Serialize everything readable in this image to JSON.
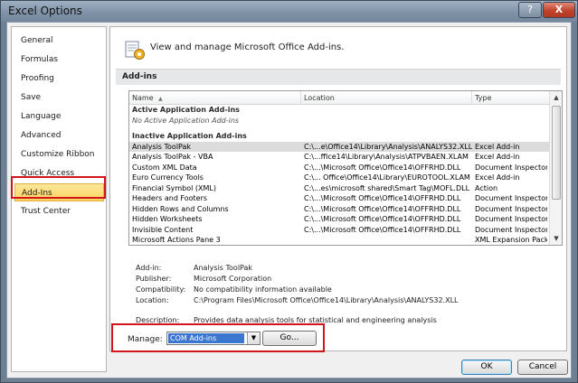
{
  "window": {
    "title": "Excel Options",
    "help_glyph": "?",
    "close_glyph": "X"
  },
  "nav": {
    "items": [
      {
        "label": "General"
      },
      {
        "label": "Formulas"
      },
      {
        "label": "Proofing"
      },
      {
        "label": "Save"
      },
      {
        "label": "Language"
      },
      {
        "label": "Advanced"
      },
      {
        "label": "Customize Ribbon"
      },
      {
        "label": "Quick Access Toolbar"
      },
      {
        "label": "Add-Ins",
        "selected": true
      },
      {
        "label": "Trust Center"
      }
    ]
  },
  "header": {
    "text": "View and manage Microsoft Office Add-ins.",
    "icon": "addins-gear-icon"
  },
  "section": {
    "title": "Add-ins"
  },
  "grid": {
    "columns": [
      "Name",
      "Location",
      "Type"
    ],
    "sort_glyph": "▲",
    "active_group": "Active Application Add-ins",
    "active_empty": "No Active Application Add-ins",
    "inactive_group": "Inactive Application Add-ins",
    "rows": [
      {
        "name": "Analysis ToolPak",
        "location": "C:\\...e\\Office14\\Library\\Analysis\\ANALYS32.XLL",
        "type": "Excel Add-in",
        "selected": true
      },
      {
        "name": "Analysis ToolPak - VBA",
        "location": "C:\\...ffice14\\Library\\Analysis\\ATPVBAEN.XLAM",
        "type": "Excel Add-in"
      },
      {
        "name": "Custom XML Data",
        "location": "C:\\...\\Microsoft Office\\Office14\\OFFRHD.DLL",
        "type": "Document Inspector"
      },
      {
        "name": "Euro Currency Tools",
        "location": "C:\\... Office\\Office14\\Library\\EUROTOOL.XLAM",
        "type": "Excel Add-in"
      },
      {
        "name": "Financial Symbol (XML)",
        "location": "C:\\...es\\microsoft shared\\Smart Tag\\MOFL.DLL",
        "type": "Action"
      },
      {
        "name": "Headers and Footers",
        "location": "C:\\...\\Microsoft Office\\Office14\\OFFRHD.DLL",
        "type": "Document Inspector"
      },
      {
        "name": "Hidden Rows and Columns",
        "location": "C:\\...\\Microsoft Office\\Office14\\OFFRHD.DLL",
        "type": "Document Inspector"
      },
      {
        "name": "Hidden Worksheets",
        "location": "C:\\...\\Microsoft Office\\Office14\\OFFRHD.DLL",
        "type": "Document Inspector"
      },
      {
        "name": "Invisible Content",
        "location": "C:\\...\\Microsoft Office\\Office14\\OFFRHD.DLL",
        "type": "Document Inspector"
      },
      {
        "name": "Microsoft Actions Pane 3",
        "location": "",
        "type": "XML Expansion Pack"
      }
    ]
  },
  "details": {
    "addin_label": "Add-in:",
    "addin_value": "Analysis ToolPak",
    "publisher_label": "Publisher:",
    "publisher_value": "Microsoft Corporation",
    "compat_label": "Compatibility:",
    "compat_value": "No compatibility information available",
    "location_label": "Location:",
    "location_value": "C:\\Program Files\\Microsoft Office\\Office14\\Library\\Analysis\\ANALYS32.XLL",
    "desc_label": "Description:",
    "desc_value": "Provides data analysis tools for statistical and engineering analysis"
  },
  "manage": {
    "label": "Manage:",
    "selected": "COM Add-ins",
    "go_label": "Go..."
  },
  "buttons": {
    "ok": "OK",
    "cancel": "Cancel"
  },
  "colors": {
    "highlight_red": "#d2141c",
    "selection_yellow": "#fbd55f",
    "combo_blue": "#3b77d0"
  }
}
